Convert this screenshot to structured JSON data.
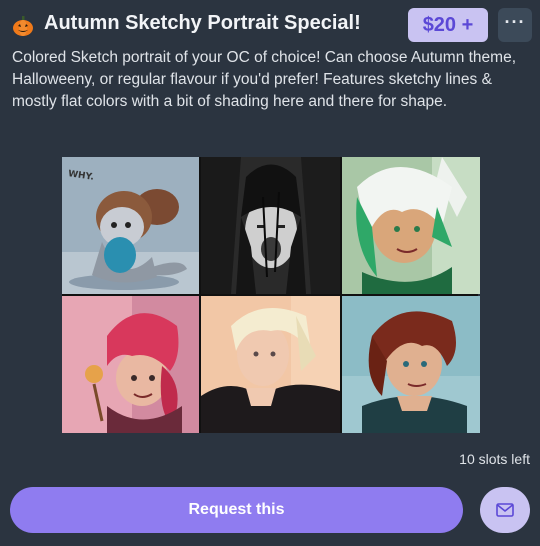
{
  "commission": {
    "title": "Autumn Sketchy Portrait Special!",
    "price": "$20 +",
    "more_label": "···",
    "description": "Colored Sketch portrait of your OC of choice! Can choose Autumn theme, Halloweeny, or regular flavour if you'd prefer! Features sketchy lines & mostly flat colors with a bit of shading here and there for shape.",
    "slots_left": "10 slots left",
    "request_label": "Request this"
  },
  "gallery": {
    "cells": [
      {
        "name": "chibi-character-art",
        "caption": "WHY."
      },
      {
        "name": "monochrome-screaming-portrait"
      },
      {
        "name": "white-green-hair-portrait"
      },
      {
        "name": "pink-hair-portrait"
      },
      {
        "name": "blonde-fur-collar-portrait"
      },
      {
        "name": "red-hair-portrait"
      }
    ]
  },
  "icons": {
    "pumpkin": "pumpkin-icon",
    "mail": "mail-icon"
  },
  "colors": {
    "background": "#2b3440",
    "accent": "#8f7cf0",
    "price_bg": "#c9c3f2",
    "price_text": "#5b48d6"
  }
}
